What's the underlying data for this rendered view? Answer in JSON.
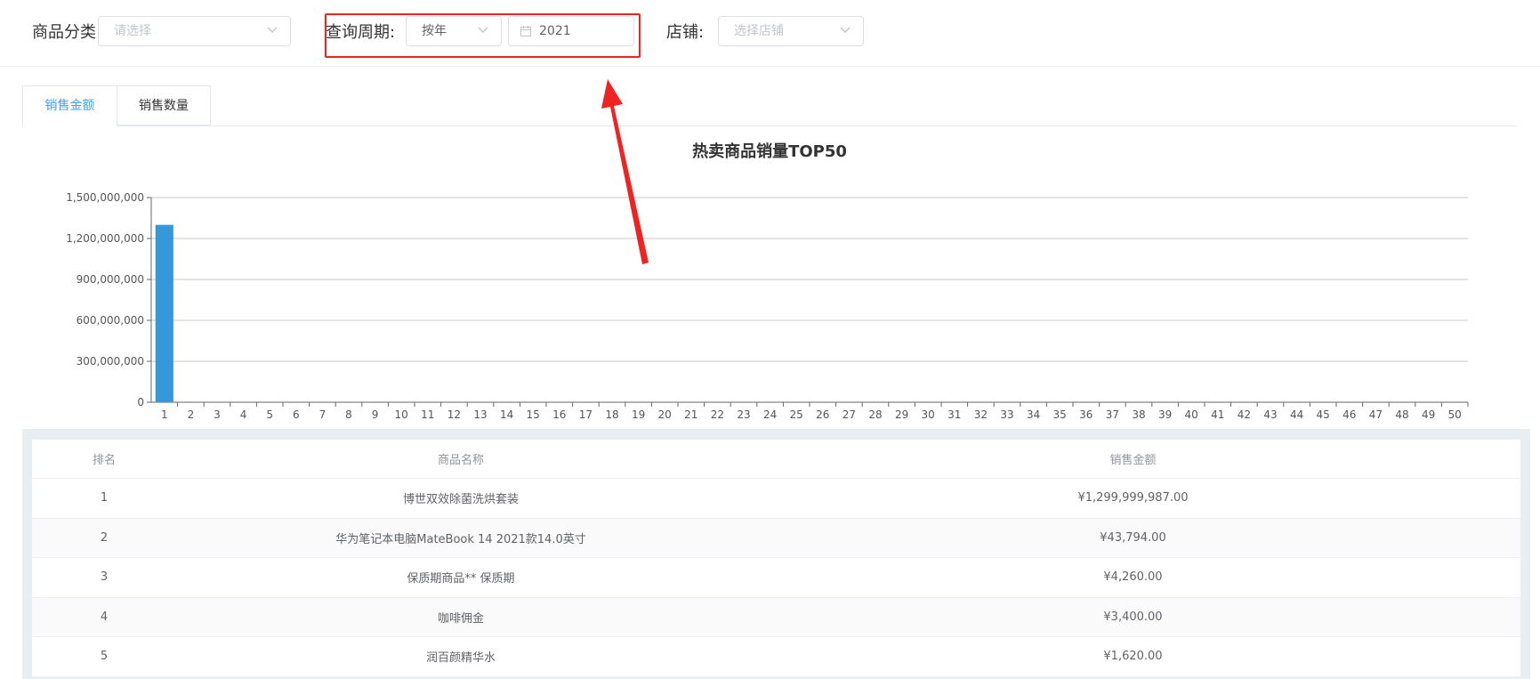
{
  "filters": {
    "category_label": "商品分类",
    "category_placeholder": "请选择",
    "period_label": "查询周期:",
    "period_value": "按年",
    "year_value": "2021",
    "store_label": "店铺:",
    "store_placeholder": "选择店铺"
  },
  "tabs": [
    {
      "label": "销售金额",
      "active": true
    },
    {
      "label": "销售数量",
      "active": false
    }
  ],
  "colors": {
    "accent": "#409eff",
    "bar": "#3498db",
    "highlight": "#f02222"
  },
  "chart_data": {
    "type": "bar",
    "title": "热卖商品销量TOP50",
    "categories": [
      "1",
      "2",
      "3",
      "4",
      "5",
      "6",
      "7",
      "8",
      "9",
      "10",
      "11",
      "12",
      "13",
      "14",
      "15",
      "16",
      "17",
      "18",
      "19",
      "20",
      "21",
      "22",
      "23",
      "24",
      "25",
      "26",
      "27",
      "28",
      "29",
      "30",
      "31",
      "32",
      "33",
      "34",
      "35",
      "36",
      "37",
      "38",
      "39",
      "40",
      "41",
      "42",
      "43",
      "44",
      "45",
      "46",
      "47",
      "48",
      "49",
      "50"
    ],
    "values": [
      1299999987,
      43794,
      4260,
      3400,
      1620,
      0,
      0,
      0,
      0,
      0,
      0,
      0,
      0,
      0,
      0,
      0,
      0,
      0,
      0,
      0,
      0,
      0,
      0,
      0,
      0,
      0,
      0,
      0,
      0,
      0,
      0,
      0,
      0,
      0,
      0,
      0,
      0,
      0,
      0,
      0,
      0,
      0,
      0,
      0,
      0,
      0,
      0,
      0,
      0,
      0
    ],
    "yticks": [
      "0",
      "300,000,000",
      "600,000,000",
      "900,000,000",
      "1,200,000,000",
      "1,500,000,000"
    ],
    "ylim": [
      0,
      1500000000
    ],
    "grid": true
  },
  "table": {
    "headers": [
      "排名",
      "商品名称",
      "销售金额"
    ],
    "rows": [
      {
        "rank": "1",
        "name": "博世双效除菌洗烘套装",
        "amount": "¥1,299,999,987.00"
      },
      {
        "rank": "2",
        "name": "华为笔记本电脑MateBook 14 2021款14.0英寸",
        "amount": "¥43,794.00"
      },
      {
        "rank": "3",
        "name": "保质期商品** 保质期",
        "amount": "¥4,260.00"
      },
      {
        "rank": "4",
        "name": "咖啡佣金",
        "amount": "¥3,400.00"
      },
      {
        "rank": "5",
        "name": "润百颜精华水",
        "amount": "¥1,620.00"
      }
    ]
  }
}
